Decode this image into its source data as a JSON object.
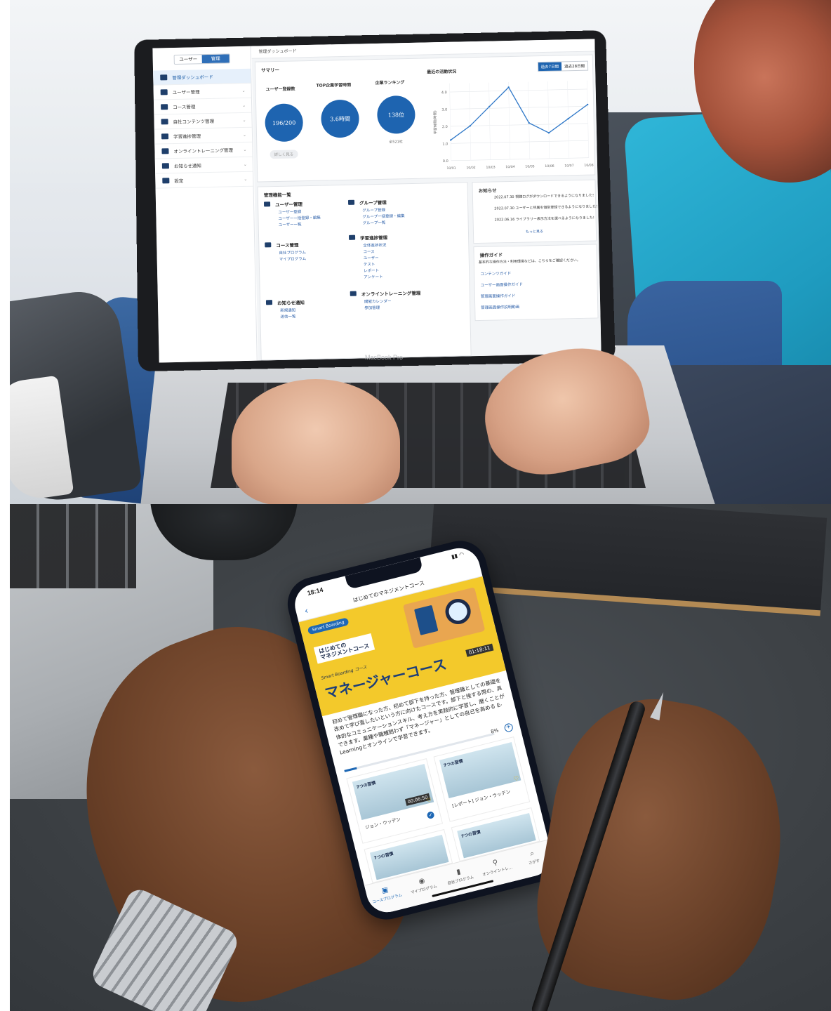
{
  "dashboard": {
    "sidebar": {
      "toggle": [
        "ユーザー",
        "管理"
      ],
      "items": [
        {
          "label": "管理ダッシュボード",
          "icon": "home-icon"
        },
        {
          "label": "ユーザー管理",
          "icon": "users-icon"
        },
        {
          "label": "コース管理",
          "icon": "course-icon"
        },
        {
          "label": "自社コンテンツ管理",
          "icon": "folder-icon"
        },
        {
          "label": "学習進捗管理",
          "icon": "progress-icon"
        },
        {
          "label": "オンライントレーニング管理",
          "icon": "training-icon"
        },
        {
          "label": "お知らせ通知",
          "icon": "mail-icon"
        },
        {
          "label": "設定",
          "icon": "gear-icon"
        }
      ]
    },
    "breadcrumb": "管理ダッシュボード",
    "summary": {
      "title": "サマリー",
      "stats": [
        {
          "label": "ユーザー登録数",
          "value": "196/200"
        },
        {
          "label": "TOP企業学習時間",
          "value": "3.6時間"
        },
        {
          "label": "企業ランキング",
          "value": "138位"
        }
      ],
      "detail_button": "詳しく見る",
      "ranking_total": "全521社",
      "chart_title": "最近の活動状況",
      "period_tabs": [
        "過去7日間",
        "過去28日間"
      ]
    },
    "chart_data": {
      "type": "line",
      "title": "最近の活動状況",
      "categories": [
        "10/01",
        "10/02",
        "10/03",
        "10/04",
        "10/05",
        "10/06",
        "10/07",
        "10/08"
      ],
      "values": [
        1.2,
        2.0,
        3.1,
        4.2,
        2.1,
        1.5,
        2.3,
        3.1
      ],
      "ylim": [
        0,
        4.5
      ],
      "ylabel": "学習時間(時間)",
      "ticks_y": [
        "0.0",
        "1.0",
        "2.0",
        "3.0",
        "4.0"
      ]
    },
    "menu_list": {
      "title": "管理機能一覧",
      "groups": [
        {
          "title": "ユーザー管理",
          "links": [
            "ユーザー登録",
            "ユーザー一括登録・編集",
            "ユーザー一覧"
          ]
        },
        {
          "title": "グループ管理",
          "links": [
            "グループ登録",
            "グループ一括登録・編集",
            "グループ一覧"
          ]
        },
        {
          "title": "コース管理",
          "links": [
            "自社プログラム",
            "マイプログラム"
          ]
        },
        {
          "title": "学習進捗管理",
          "links": [
            "全体進捗状況",
            "コース",
            "ユーザー",
            "テスト",
            "レポート",
            "アンケート"
          ]
        },
        {
          "title": "お知らせ通知",
          "links": [
            "新規通知",
            "送信一覧"
          ]
        },
        {
          "title": "オンライントレーニング管理",
          "links": [
            "開催カレンダー",
            "参加管理"
          ]
        }
      ]
    },
    "news": {
      "title": "お知らせ",
      "items": [
        {
          "date": "2022.07.30",
          "text": "視聴ログがダウンロードできるようになりました!"
        },
        {
          "date": "2022.07.30",
          "text": "ユーザーと所属を個別登録できるようになりました!"
        },
        {
          "date": "2022.06.16",
          "text": "ライブラリー表示方法を選べるようになりました!"
        }
      ],
      "more": "もっと見る"
    },
    "guide": {
      "title": "操作ガイド",
      "intro": "基本的な操作方法・利用環境などは、こちらをご確認ください。",
      "links": [
        "コンテンツガイド",
        "ユーザー画面操作ガイド",
        "管理画面操作ガイド",
        "管理画面操作説明動画"
      ]
    },
    "device_label": "MacBook Pro"
  },
  "phone": {
    "time": "18:14",
    "header_title": "はじめてのマネジメントコース",
    "brand": "Smart Boarding",
    "banner_subtitle_1": "はじめての",
    "banner_subtitle_2": "マネジメントコース",
    "banner_tag": "Smart Boarding コース",
    "banner_title": "マネージャーコース",
    "banner_duration": "01:18:11",
    "description": "初めて管理職になった方、初めて部下を持った方、管理職としての基礎を改めて学び直したいという方に向けたコースです。部下と接する際の、具体的なコミュニケーションスキル、考え方を実践的に学習し、磨くことができます。業種や職種問わず「マネージャー」としての自己を高める E-Learningとオンラインで学習できます。",
    "progress_label": "8%",
    "progress_value": 0.08,
    "tiles": [
      {
        "thumb_label": "7つの習慣",
        "duration": "00:06:50",
        "name": "ジョン・ウッデン"
      },
      {
        "thumb_label": "7つの習慣",
        "duration": "",
        "name": "[レポート] ジョン・ウッデン"
      },
      {
        "thumb_label": "7つの習慣",
        "duration": "",
        "name": ""
      },
      {
        "thumb_label": "7つの習慣",
        "duration": "",
        "name": ""
      }
    ],
    "tabs": [
      "コースプログラム",
      "マイプログラム",
      "自社プログラム",
      "オンライントレ...",
      "さがす"
    ]
  },
  "colors": {
    "brand_blue": "#1e64b0",
    "banner_yellow": "#f3c92b",
    "cushion_teal": "#2fb6d8"
  }
}
